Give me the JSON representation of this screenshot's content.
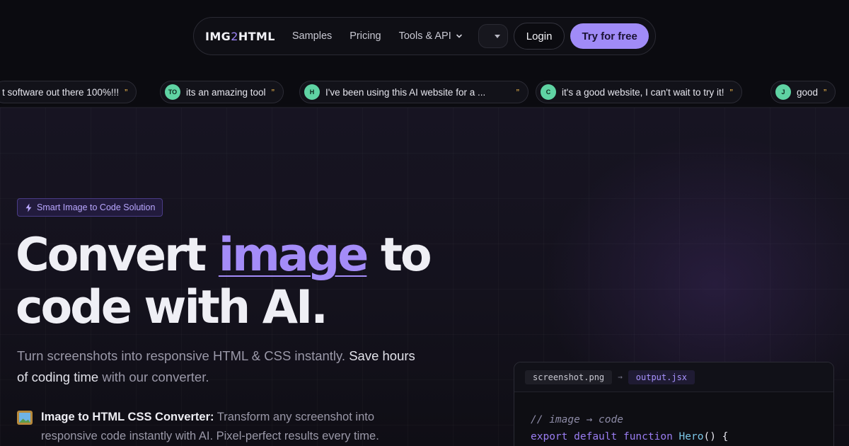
{
  "nav": {
    "logo_prefix": "IMG",
    "logo_two": "2",
    "logo_suffix": "HTML",
    "links": [
      "Samples",
      "Pricing",
      "Tools & API"
    ],
    "login_label": "Login",
    "cta_label": "Try for free"
  },
  "testimonials": [
    {
      "avatar": "",
      "text": "t software out there 100%!!!"
    },
    {
      "avatar": "TO",
      "text": "its an amazing tool"
    },
    {
      "avatar": "H",
      "text": "I've been using this AI website for a ..."
    },
    {
      "avatar": "C",
      "text": "it's a good website, I can't wait to try it!"
    },
    {
      "avatar": "J",
      "text": "good"
    }
  ],
  "quote_mark": "”",
  "hero": {
    "badge": "Smart Image to Code Solution",
    "headline_1": "Convert ",
    "headline_highlight": "image",
    "headline_2": " to",
    "headline_3": "code with AI.",
    "sub_plain_1": "Turn screenshots into responsive HTML & CSS instantly. ",
    "sub_bold": "Save hours of coding time",
    "sub_plain_2": " with our converter.",
    "feature_title": "Image to HTML CSS Converter:",
    "feature_text": " Transform any screenshot into responsive code instantly with AI. Pixel-perfect results every time."
  },
  "code_window": {
    "tab_input": "screenshot.png",
    "arrow": "→",
    "tab_output": "output.jsx",
    "line1_comment": "// image → code",
    "line2_kw1": "export",
    "line2_kw2": "default",
    "line2_kw3": "function",
    "line2_fn": "Hero",
    "line2_rest": "() {"
  },
  "colors": {
    "accent": "#a08bf7",
    "avatar_green": "#5fd3a3",
    "quote_gold": "#e8b34a"
  }
}
